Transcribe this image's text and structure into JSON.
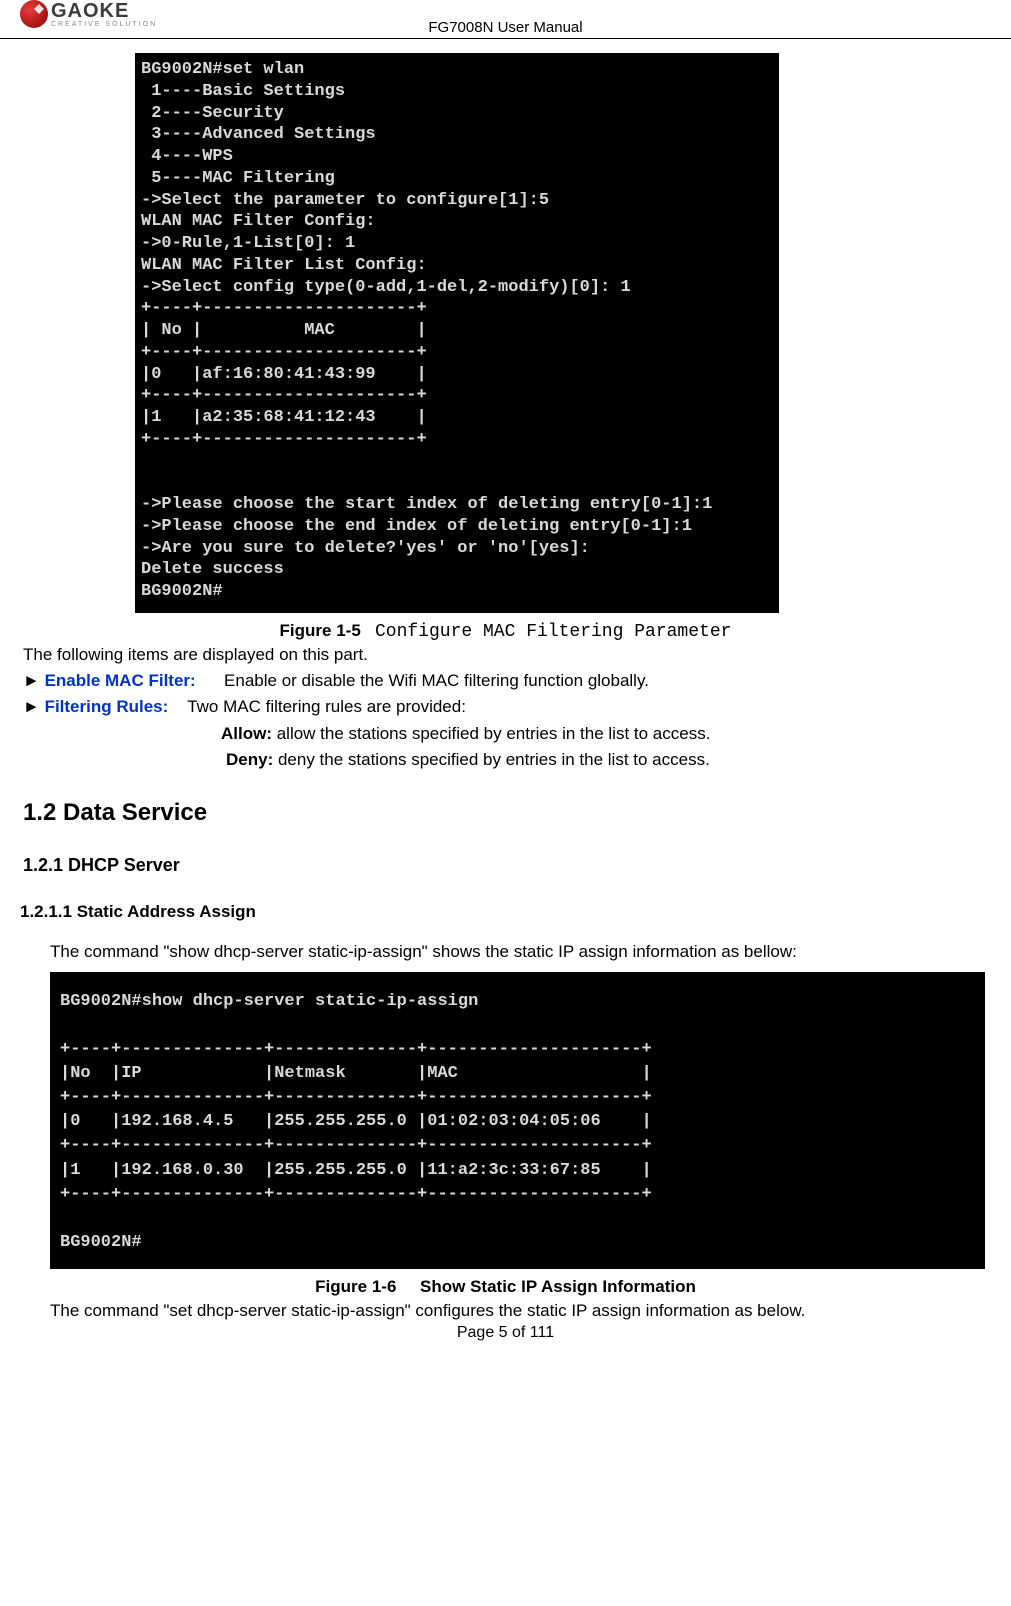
{
  "header": {
    "logo_title": "GAOKE",
    "logo_sub": "CREATIVE SOLUTION",
    "doc_title": "FG7008N User Manual"
  },
  "terminal1": "BG9002N#set wlan\n 1----Basic Settings\n 2----Security\n 3----Advanced Settings\n 4----WPS\n 5----MAC Filtering\n->Select the parameter to configure[1]:5\nWLAN MAC Filter Config:\n->0-Rule,1-List[0]: 1\nWLAN MAC Filter List Config:\n->Select config type(0-add,1-del,2-modify)[0]: 1\n+----+---------------------+\n| No |          MAC        |\n+----+---------------------+\n|0   |af:16:80:41:43:99    |\n+----+---------------------+\n|1   |a2:35:68:41:12:43    |\n+----+---------------------+\n\n\n->Please choose the start index of deleting entry[0-1]:1\n->Please choose the end index of deleting entry[0-1]:1\n->Are you sure to delete?'yes' or 'no'[yes]:\nDelete success\nBG9002N#",
  "fig1": {
    "label": "Figure 1-5",
    "title": "Configure MAC Filtering Parameter"
  },
  "body": {
    "intro": "The following items are displayed on this part.",
    "l1_label": "Enable MAC Filter:",
    "l1_text": "Enable or disable the Wifi MAC filtering function globally.",
    "l2_label": "Filtering Rules:",
    "l2_text": "Two MAC filtering rules are provided:",
    "allow_b": "Allow:",
    "allow_t": " allow the stations specified by entries in the list to access.",
    "deny_b": "Deny:",
    "deny_t": " deny the stations specified by entries in the list to access."
  },
  "h2": "1.2  Data Service",
  "h3": "1.2.1    DHCP Server",
  "h4": "1.2.1.1    Static Address Assign",
  "p2": "The command \"show dhcp-server static-ip-assign\" shows the static IP assign information as bellow:",
  "terminal2": "BG9002N#show dhcp-server static-ip-assign\n\n+----+--------------+--------------+---------------------+\n|No  |IP            |Netmask       |MAC                  |\n+----+--------------+--------------+---------------------+\n|0   |192.168.4.5   |255.255.255.0 |01:02:03:04:05:06    |\n+----+--------------+--------------+---------------------+\n|1   |192.168.0.30  |255.255.255.0 |11:a2:3c:33:67:85    |\n+----+--------------+--------------+---------------------+\n\nBG9002N#",
  "fig2": {
    "label": "Figure 1-6",
    "title": "Show Static IP Assign Information"
  },
  "p3": "The command \"set dhcp-server static-ip-assign\" configures the static IP assign information as below.",
  "footer": "Page 5 of 111"
}
